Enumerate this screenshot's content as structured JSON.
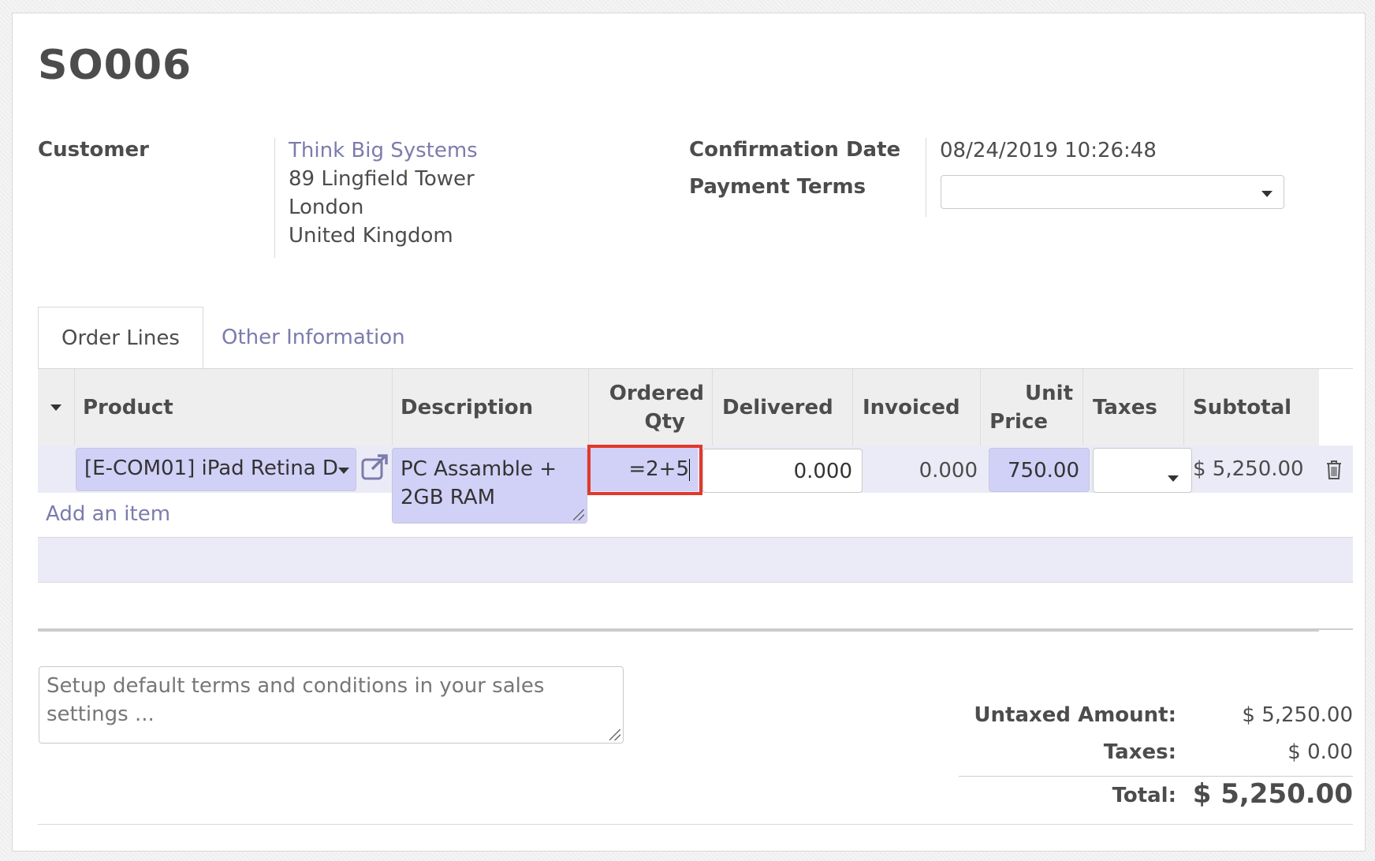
{
  "order": {
    "name": "SO006"
  },
  "customer": {
    "label": "Customer",
    "name": "Think Big Systems",
    "address_line1": "89 Lingfield Tower",
    "address_line2": "London",
    "address_line3": "United Kingdom"
  },
  "confirmation": {
    "label": "Confirmation Date",
    "value": "08/24/2019 10:26:48"
  },
  "payment_terms": {
    "label": "Payment Terms",
    "value": ""
  },
  "tabs": [
    {
      "label": "Order Lines",
      "active": true
    },
    {
      "label": "Other Information",
      "active": false
    }
  ],
  "table": {
    "headers": {
      "product": "Product",
      "description": "Description",
      "ordered_qty_1": "Ordered",
      "ordered_qty_2": "Qty",
      "delivered": "Delivered",
      "invoiced": "Invoiced",
      "unit_price_1": "Unit",
      "unit_price_2": "Price",
      "taxes": "Taxes",
      "subtotal": "Subtotal"
    },
    "row": {
      "product": "[E-COM01] iPad Retina D",
      "description_1": "PC Assamble +",
      "description_2": "2GB RAM",
      "ordered_qty": "=2+5",
      "delivered": "0.000",
      "invoiced": "0.000",
      "unit_price": "750.00",
      "taxes": "",
      "subtotal": "$ 5,250.00"
    },
    "add_item": "Add an item"
  },
  "notes": {
    "placeholder": "Setup default terms and conditions in your sales settings ..."
  },
  "totals": {
    "untaxed_label": "Untaxed Amount:",
    "untaxed_value": "$ 5,250.00",
    "taxes_label": "Taxes:",
    "taxes_value": "$ 0.00",
    "total_label": "Total:",
    "total_value": "$ 5,250.00"
  },
  "colors": {
    "link": "#7c7bad",
    "edit_cell_bg": "#d1d0f6",
    "row_bg": "#ebebf7",
    "highlight_border": "#e0392b"
  },
  "icons": [
    "sort-caret-icon",
    "external-link-icon",
    "dropdown-caret-icon",
    "trash-icon",
    "resize-handle-icon"
  ]
}
